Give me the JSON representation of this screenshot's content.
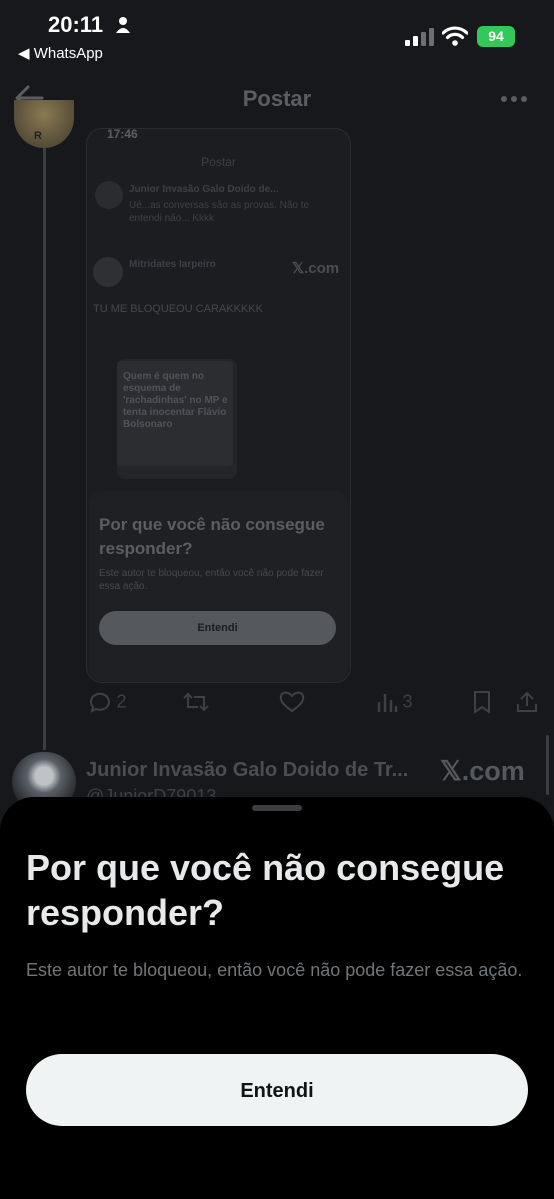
{
  "status_bar": {
    "time": "20:11",
    "back_app": "◀ WhatsApp",
    "battery": "94"
  },
  "header": {
    "title": "Postar"
  },
  "embedded_screenshot": {
    "time": "17:46",
    "title": "Postar",
    "reply_author": "Junior Invasão Galo Doido de...",
    "reply_text": "Ué...as conversas são as provas. Não te entendi não... Kkkk",
    "quoted_author": "Mitridates Iarpeiro",
    "x_logo": "𝕏.com",
    "post_text": "TU ME BLOQUEOU CARAKKKKK",
    "thumb_text": "Quem é quem no esquema de 'rachadinhas' no MP e tenta inocentar Flávio Bolsonaro",
    "sheet_title": "Por que você não consegue responder?",
    "sheet_subtitle": "Este autor te bloqueou, então você não pode fazer essa ação.",
    "sheet_button": "Entendi"
  },
  "actions": {
    "replies": "2",
    "views": "3"
  },
  "second_tweet": {
    "name": "Junior Invasão Galo Doido de Tr...",
    "handle": "@JuniorD79013",
    "x_logo": "𝕏.com"
  },
  "bottom_sheet": {
    "title": "Por que você não consegue responder?",
    "subtitle": "Este autor te bloqueou, então você não pode fazer essa ação.",
    "button": "Entendi"
  },
  "colors": {
    "background": "#16181c",
    "sheet": "#000000",
    "button": "#eff3f4",
    "battery": "#34c759"
  }
}
